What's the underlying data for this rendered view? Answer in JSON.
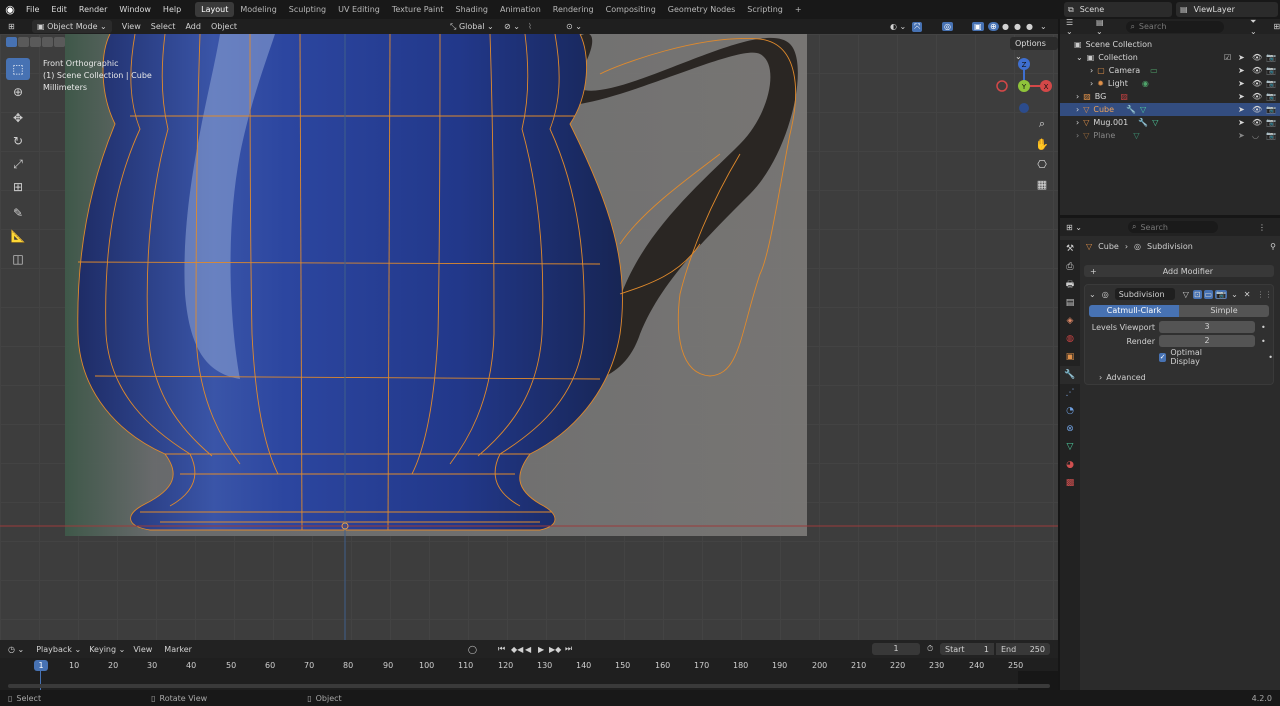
{
  "topbar": {
    "menu": [
      "File",
      "Edit",
      "Render",
      "Window",
      "Help"
    ],
    "workspaces": [
      "Layout",
      "Modeling",
      "Sculpting",
      "UV Editing",
      "Texture Paint",
      "Shading",
      "Animation",
      "Rendering",
      "Compositing",
      "Geometry Nodes",
      "Scripting"
    ],
    "active_workspace": "Layout",
    "scene": "Scene",
    "view_layer": "ViewLayer"
  },
  "viewport_header": {
    "mode": "Object Mode",
    "menus": [
      "View",
      "Select",
      "Add",
      "Object"
    ],
    "transform_orientation": "Global",
    "options": "Options"
  },
  "viewport": {
    "view_name": "Front Orthographic",
    "collection_info": "(1) Scene Collection | Cube",
    "units": "Millimeters",
    "gizmo": {
      "z": "Z",
      "y": "Y",
      "x": "X"
    }
  },
  "outliner": {
    "search_placeholder": "Search",
    "root": "Scene Collection",
    "items": [
      {
        "name": "Collection",
        "indent": 1
      },
      {
        "name": "Camera",
        "indent": 2
      },
      {
        "name": "Light",
        "indent": 2
      },
      {
        "name": "BG",
        "indent": 1
      },
      {
        "name": "Cube",
        "indent": 1
      },
      {
        "name": "Mug.001",
        "indent": 1
      },
      {
        "name": "Plane",
        "indent": 1
      }
    ]
  },
  "properties": {
    "search_placeholder": "Search",
    "breadcrumb_object": "Cube",
    "breadcrumb_modifier": "Subdivision",
    "add_modifier": "Add Modifier",
    "modifier_name": "Subdivision",
    "method_catmull": "Catmull-Clark",
    "method_simple": "Simple",
    "levels_viewport_label": "Levels Viewport",
    "levels_viewport_value": "3",
    "render_label": "Render",
    "render_value": "2",
    "optimal_display": "Optimal Display",
    "advanced": "Advanced"
  },
  "timeline": {
    "menus": [
      "Playback",
      "Keying",
      "View",
      "Marker"
    ],
    "current_frame": "1",
    "start_label": "Start",
    "start_value": "1",
    "end_label": "End",
    "end_value": "250",
    "ticks": [
      "1",
      "10",
      "20",
      "30",
      "40",
      "50",
      "60",
      "70",
      "80",
      "90",
      "100",
      "110",
      "120",
      "130",
      "140",
      "150",
      "160",
      "170",
      "180",
      "190",
      "200",
      "210",
      "220",
      "230",
      "240",
      "250"
    ]
  },
  "status": {
    "select": "Select",
    "rotate_view": "Rotate View",
    "object": "Object",
    "version": "4.2.0"
  },
  "colors": {
    "accent": "#4772b3",
    "wire": "#e08a2c",
    "mug_blue": "#2a3f8a"
  }
}
